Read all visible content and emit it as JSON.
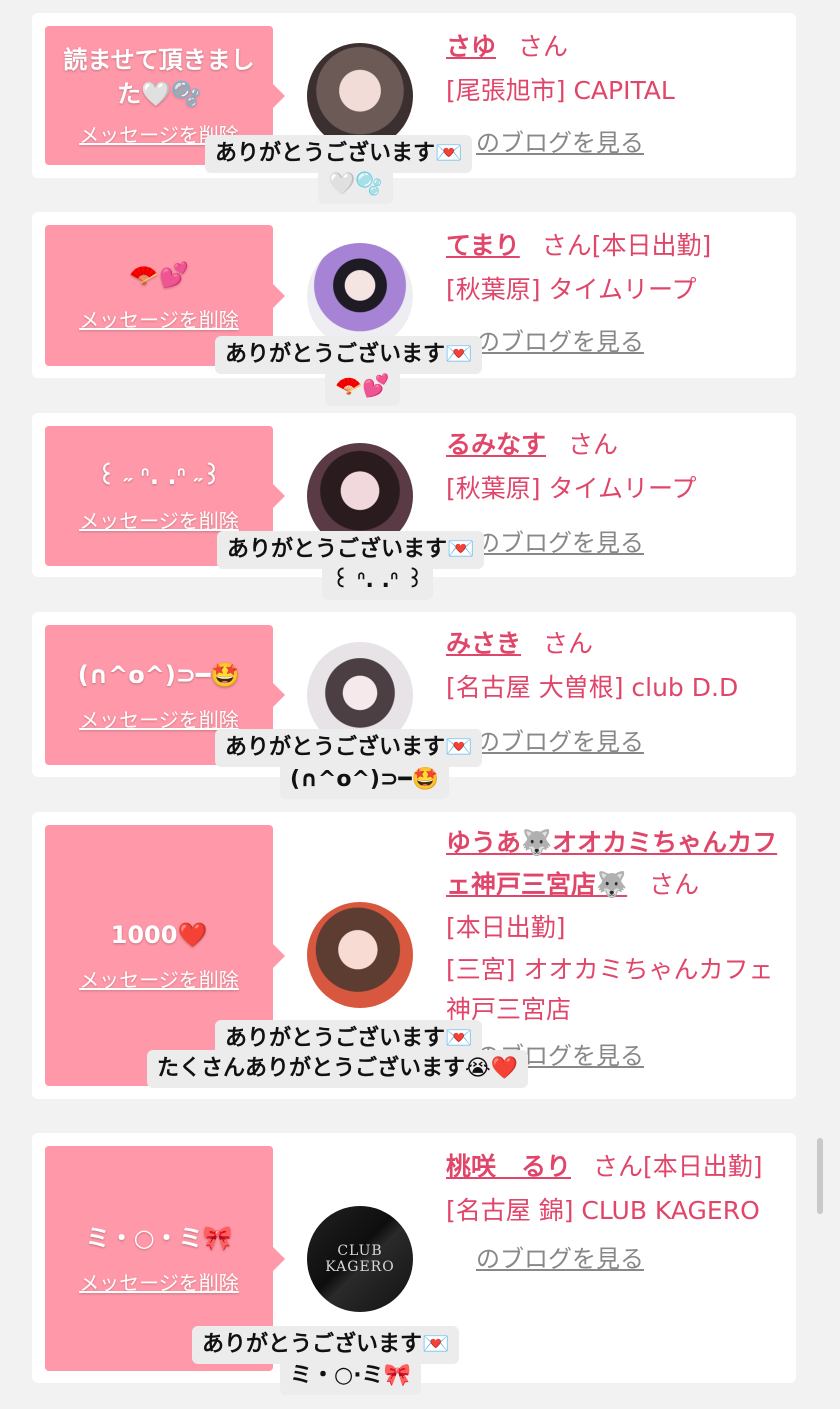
{
  "delete_label": "メッセージを削除",
  "blog_label": "のブログを見る",
  "suffix": "さん",
  "thanks_label": "ありがとうございます💌",
  "cards": [
    {
      "message": "読ませて頂きました🤍🫧",
      "name": "さゆ",
      "after_name": "",
      "lines": [
        "[尾張旭市] CAPITAL"
      ],
      "reply": "🤍🫧"
    },
    {
      "message": "🪭💕",
      "name": "てまり",
      "after_name": "[本日出勤]",
      "lines": [
        "[秋葉原] タイムリープ"
      ],
      "reply": "🪭💕"
    },
    {
      "message": "꒰ ˶ ᐢ. .ᐢ ˶꒱",
      "name": "るみなす",
      "after_name": "",
      "lines": [
        "[秋葉原] タイムリープ"
      ],
      "reply": "꒰ ᐢ. .ᐢ ꒱"
    },
    {
      "message": "(∩^o^)⊃━🤩",
      "name": "みさき",
      "after_name": "",
      "lines": [
        "[名古屋 大曽根] club D.D"
      ],
      "reply": "(∩^o^)⊃━🤩"
    },
    {
      "message": "1000❤️",
      "name": "ゆうあ🐺オオカミちゃんカフェ神戸三宮店🐺",
      "after_name": "",
      "lines": [
        "[本日出勤]",
        "[三宮] オオカミちゃんカフェ神戸三宮店"
      ],
      "reply": "たくさんありがとうございます😭❤️"
    },
    {
      "message": "ミ・○・ミ🎀",
      "name": "桃咲　るり",
      "after_name": "[本日出勤]",
      "lines": [
        "[名古屋 錦] CLUB KAGERO"
      ],
      "reply": "ミ・○·ミ🎀",
      "avatar_text": "CLUB KAGERO"
    }
  ]
}
